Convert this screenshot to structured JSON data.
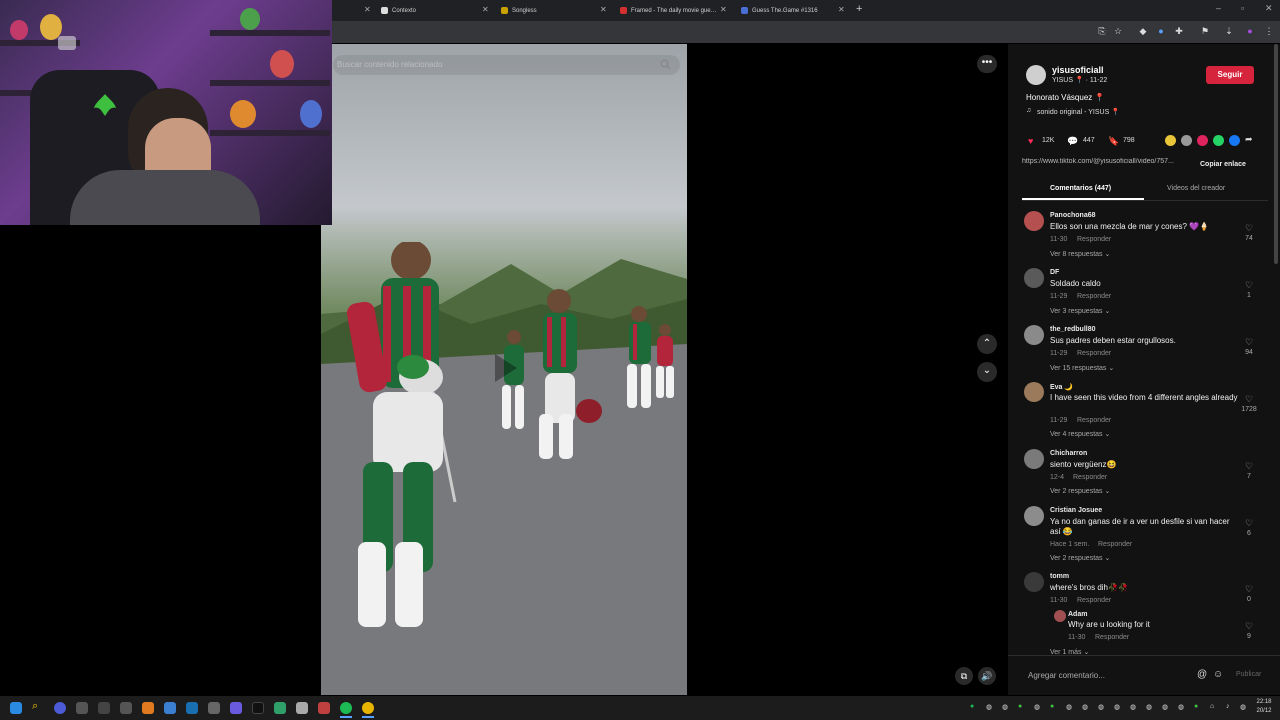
{
  "browser": {
    "tabs": [
      {
        "label": "Contexto"
      },
      {
        "label": "Songless"
      },
      {
        "label": "Framed - The daily movie gue…"
      },
      {
        "label": "Guess The.Game #1316"
      }
    ],
    "new_tab": "+"
  },
  "search": {
    "placeholder": "Buscar contenido relacionado"
  },
  "video": {
    "more_icon": "more-horizontal-icon"
  },
  "panel": {
    "username": "yisusoficiall",
    "display_line": "YISUS 📍 · 11-22",
    "follow": "Seguir",
    "caption": "Honorato Vásquez 📍",
    "sound": "sonido original - YISUS 📍",
    "likes": "12K",
    "comments_count": "447",
    "saves": "798",
    "url": "https://www.tiktok.com/@yisusoficiall/video/757...",
    "copy": "Copiar enlace",
    "tab_comments": "Comentarios (447)",
    "tab_creator": "Videos del creador",
    "reply": "Responder",
    "add_comment": "Agregar comentario...",
    "publish": "Publicar"
  },
  "comments": [
    {
      "user": "Panochona68",
      "text": "Ellos son una mezcla de mar y cones? 💜🍦",
      "time": "11-30",
      "replies": "Ver 8 respuestas ⌄",
      "likes": "74"
    },
    {
      "user": "DF",
      "text": "Soldado caldo",
      "time": "11-29",
      "replies": "Ver 3 respuestas ⌄",
      "likes": "1"
    },
    {
      "user": "the_redbull80",
      "text": "Sus padres deben estar orgullosos.",
      "time": "11-29",
      "replies": "Ver 15 respuestas ⌄",
      "likes": "94"
    },
    {
      "user": "Eva 🌙",
      "text": "I have seen this video from 4 different angles already",
      "time": "11-29",
      "replies": "Ver 4 respuestas ⌄",
      "likes": "1728"
    },
    {
      "user": "Chicharron",
      "text": "siento vergüenz😆",
      "time": "12-4",
      "replies": "Ver 2 respuestas ⌄",
      "likes": "7"
    },
    {
      "user": "Cristian Josuee",
      "text": "Ya no dan ganas de ir a ver un desfile si van hacer así 😂",
      "time": "Hace 1 sem.",
      "replies": "Ver 2 respuestas ⌄",
      "likes": "6"
    },
    {
      "user": "tomm",
      "text": "where's bros dih🥀🥀",
      "time": "11-30",
      "replies": "Ver 1 más ⌄",
      "likes": "0"
    }
  ],
  "nested_reply": {
    "user": "Adam",
    "text": "Why are u looking for it",
    "time": "11-30",
    "likes": "9"
  },
  "taskbar": {
    "time": "22:18",
    "date": "20/12"
  }
}
